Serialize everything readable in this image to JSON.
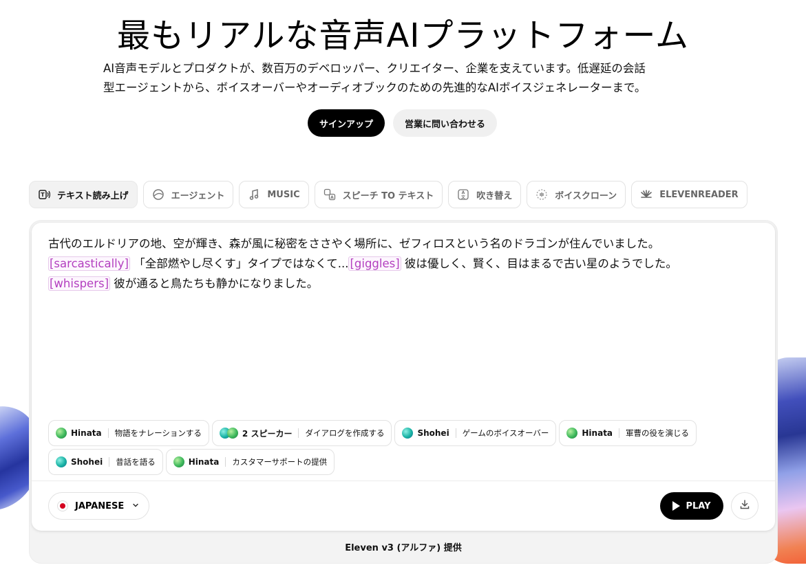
{
  "hero": {
    "title": "最もリアルな音声AIプラットフォーム",
    "subtitle_line1": "AI音声モデルとプロダクトが、数百万のデベロッパー、クリエイター、企業を支えています。低遅延の会話",
    "subtitle_line2": "型エージェントから、ボイスオーバーやオーディオブックのための先進的なAIボイスジェネレーターまで。",
    "signup_label": "サインアップ",
    "sales_label": "営業に問い合わせる"
  },
  "tabs": [
    {
      "label": "テキスト読み上げ",
      "icon": "tts-icon",
      "active": true
    },
    {
      "label": "エージェント",
      "icon": "agent-icon",
      "active": false
    },
    {
      "label": "MUSIC",
      "icon": "music-note-icon",
      "active": false
    },
    {
      "label": "スピーチ TO テキスト",
      "icon": "speech-to-text-icon",
      "active": false
    },
    {
      "label": "吹き替え",
      "icon": "dubbing-icon",
      "active": false
    },
    {
      "label": "ボイスクローン",
      "icon": "voice-clone-icon",
      "active": false
    },
    {
      "label": "ELEVENREADER",
      "icon": "elevenreader-icon",
      "active": false
    }
  ],
  "editor": {
    "line1": "古代のエルドリアの地、空が輝き、森が風に秘密をささやく場所に、ゼフィロスという名のドラゴンが住んでいました。",
    "tag1": "[sarcastically]",
    "line2a": " 「全部燃やし尽くす」タイプではなくて...",
    "tag2": "[giggles]",
    "line2b": " 彼は優しく、賢く、目はまるで古い星のようでした。",
    "tag3": "[whispers]",
    "line3": " 彼が通ると鳥たちも静かになりました。"
  },
  "chips": [
    {
      "speaker": "Hinata",
      "task": "物語をナレーションする"
    },
    {
      "speaker": "2 スピーカー",
      "task": "ダイアログを作成する"
    },
    {
      "speaker": "Shohei",
      "task": "ゲームのボイスオーバー"
    },
    {
      "speaker": "Hinata",
      "task": "軍曹の役を演じる"
    },
    {
      "speaker": "Shohei",
      "task": "昔話を語る"
    },
    {
      "speaker": "Hinata",
      "task": "カスタマーサポートの提供"
    }
  ],
  "controls": {
    "language": "JAPANESE",
    "play_label": "PLAY"
  },
  "footer": {
    "model_note": "Eleven v3 (アルファ) 提供"
  },
  "colors": {
    "accent": "#000000",
    "tag_purple": "#b33fbf"
  }
}
